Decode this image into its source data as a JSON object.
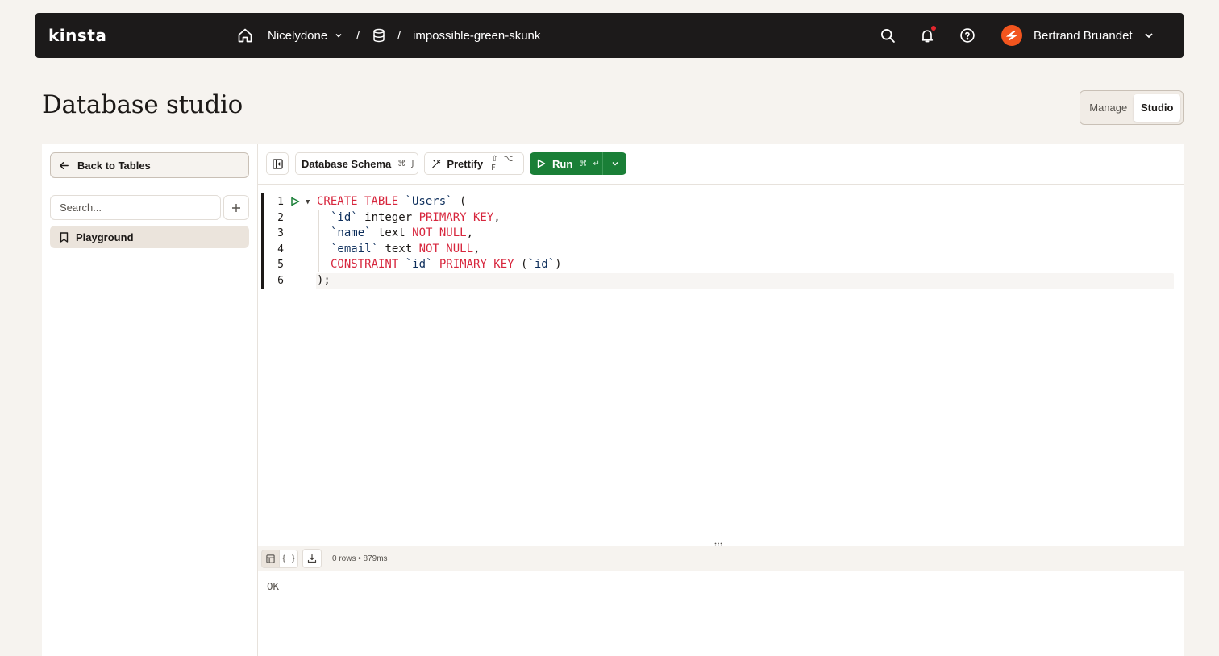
{
  "topbar": {
    "logo": "kinsta",
    "company": "Nicelydone",
    "database": "impossible-green-skunk",
    "separator": "/",
    "user_name": "Bertrand Bruandet",
    "has_notification": true
  },
  "page": {
    "title": "Database studio",
    "view_toggle": {
      "manage_label": "Manage",
      "studio_label": "Studio",
      "active": "Studio"
    }
  },
  "sidebar": {
    "back_label": "Back to Tables",
    "search_placeholder": "Search...",
    "items": [
      {
        "label": "Playground",
        "icon": "bookmark-icon",
        "selected": true
      }
    ]
  },
  "toolbar": {
    "schema_label": "Database Schema",
    "schema_shortcut": "⌘ J",
    "prettify_label": "Prettify",
    "prettify_shortcut": "⇧ ⌥ F",
    "run_label": "Run",
    "run_shortcut": "⌘ ↵"
  },
  "editor": {
    "lines": [
      {
        "n": "1",
        "tokens": [
          [
            "kw",
            "CREATE TABLE "
          ],
          [
            "id",
            "`Users`"
          ],
          [
            "p",
            " ("
          ]
        ]
      },
      {
        "n": "2",
        "tokens": [
          [
            "id",
            "`id`"
          ],
          [
            "p",
            " integer "
          ],
          [
            "kw",
            "PRIMARY KEY"
          ],
          [
            "p",
            ","
          ]
        ]
      },
      {
        "n": "3",
        "tokens": [
          [
            "id",
            "`name`"
          ],
          [
            "p",
            " text "
          ],
          [
            "kw",
            "NOT NULL"
          ],
          [
            "p",
            ","
          ]
        ]
      },
      {
        "n": "4",
        "tokens": [
          [
            "id",
            "`email`"
          ],
          [
            "p",
            " text "
          ],
          [
            "kw",
            "NOT NULL"
          ],
          [
            "p",
            ","
          ]
        ]
      },
      {
        "n": "5",
        "tokens": [
          [
            "kw",
            "CONSTRAINT "
          ],
          [
            "id",
            "`id`"
          ],
          [
            "p",
            " "
          ],
          [
            "kw",
            "PRIMARY KEY"
          ],
          [
            "p",
            " ("
          ],
          [
            "id",
            "`id`"
          ],
          [
            "p",
            ")"
          ]
        ]
      },
      {
        "n": "6",
        "tokens": [
          [
            "p",
            ");"
          ]
        ]
      }
    ]
  },
  "results": {
    "meta": "0 rows • 879ms",
    "json_tab_label": "{ }",
    "output": "OK"
  },
  "colors": {
    "accent_green": "#1a7f37",
    "keyword_red": "#d7263d",
    "identifier_navy": "#0e2f5c",
    "topbar_bg": "#1c1a1a",
    "page_bg": "#f6f3ef",
    "avatar_orange": "#f2551e"
  }
}
